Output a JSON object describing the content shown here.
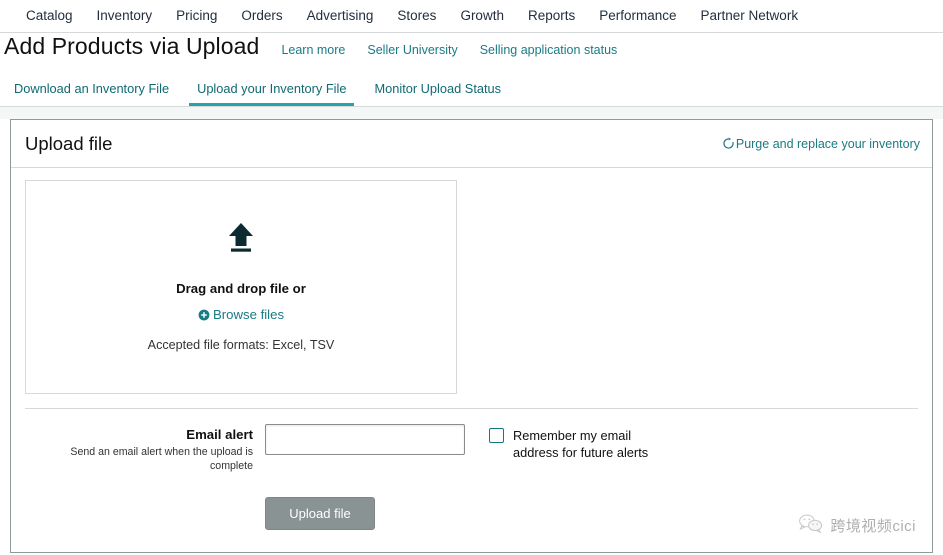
{
  "topnav": {
    "items": [
      {
        "label": "Catalog"
      },
      {
        "label": "Inventory"
      },
      {
        "label": "Pricing"
      },
      {
        "label": "Orders"
      },
      {
        "label": "Advertising"
      },
      {
        "label": "Stores"
      },
      {
        "label": "Growth"
      },
      {
        "label": "Reports"
      },
      {
        "label": "Performance"
      },
      {
        "label": "Partner Network"
      }
    ]
  },
  "page": {
    "title": "Add Products via Upload",
    "links": [
      {
        "label": "Learn more"
      },
      {
        "label": "Seller University"
      },
      {
        "label": "Selling application status"
      }
    ]
  },
  "tabs": [
    {
      "label": "Download an Inventory File",
      "active": false
    },
    {
      "label": "Upload your Inventory File",
      "active": true
    },
    {
      "label": "Monitor Upload Status",
      "active": false
    }
  ],
  "card": {
    "title": "Upload file",
    "purge_link": "Purge and replace your inventory",
    "purge_icon": "refresh-icon"
  },
  "dropzone": {
    "icon": "upload-arrow-icon",
    "drag_text": "Drag and drop file or",
    "browse_label": "Browse files",
    "browse_icon": "circle-plus-icon",
    "formats_text": "Accepted file formats: Excel, TSV"
  },
  "email_alert": {
    "label": "Email alert",
    "description": "Send an email alert when the upload is complete",
    "input_value": "",
    "input_placeholder": "",
    "checkbox_checked": false,
    "checkbox_label": "Remember my email address for future alerts"
  },
  "submit": {
    "label": "Upload file",
    "enabled": false
  },
  "watermark": {
    "text": "跨境视频cici",
    "icon": "wechat-logo-icon"
  },
  "colors": {
    "accent_teal": "#23a3ab",
    "link_teal": "#1a7b84",
    "text_dark": "#111111",
    "button_grey": "#8a9393",
    "icon_dark": "#0b2b31",
    "border_grey": "#d5d9d9"
  }
}
